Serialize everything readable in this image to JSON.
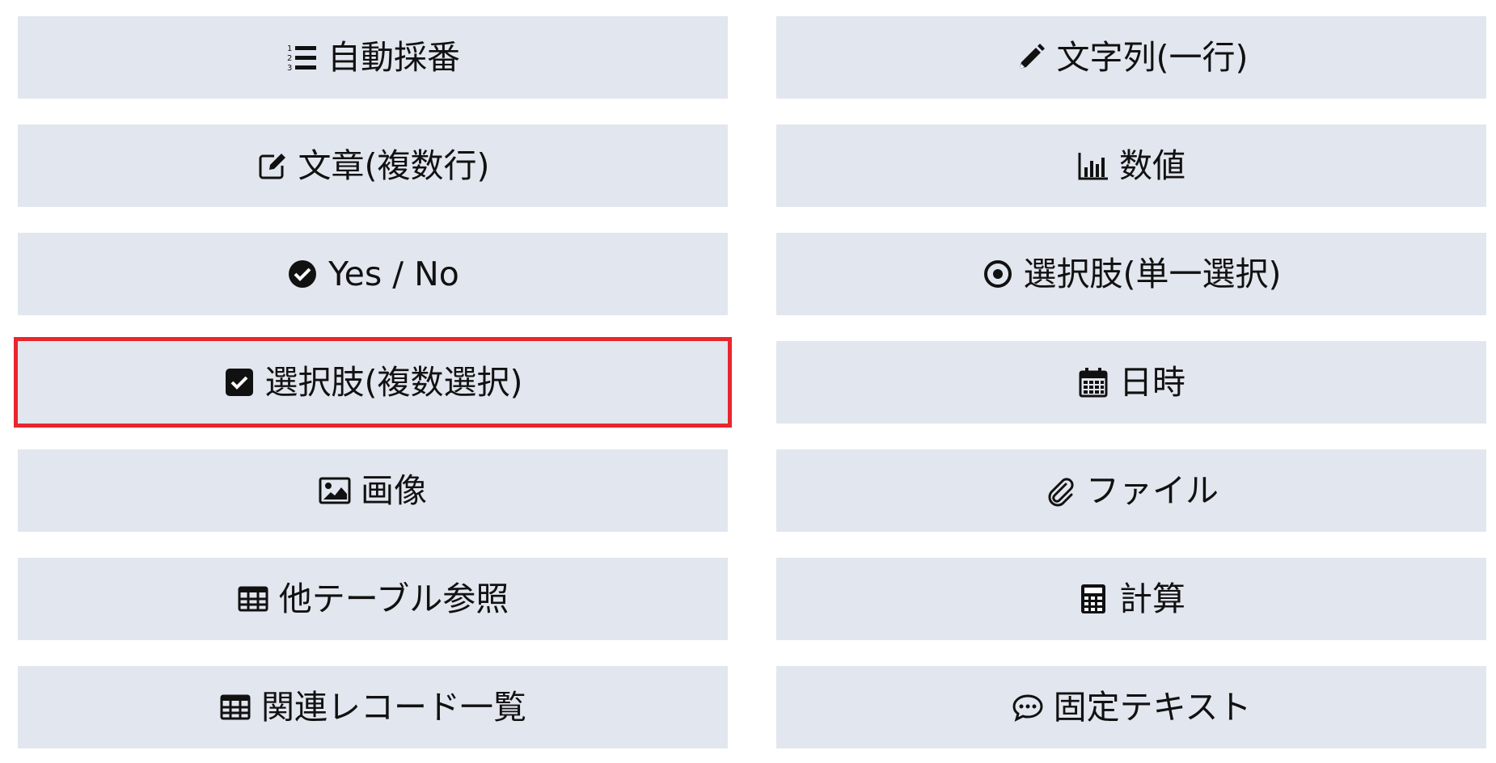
{
  "field_types": {
    "auto_number": {
      "label": "自動採番",
      "icon": "ordered-list-icon"
    },
    "text_single": {
      "label": "文字列(一行)",
      "icon": "pencil-icon"
    },
    "text_multi": {
      "label": "文章(複数行)",
      "icon": "edit-icon"
    },
    "number": {
      "label": "数値",
      "icon": "bar-chart-icon"
    },
    "yes_no": {
      "label": "Yes / No",
      "icon": "check-circle-icon"
    },
    "radio": {
      "label": "選択肢(単一選択)",
      "icon": "radio-dot-icon"
    },
    "checkbox": {
      "label": "選択肢(複数選択)",
      "icon": "check-square-icon"
    },
    "datetime": {
      "label": "日時",
      "icon": "calendar-icon"
    },
    "image": {
      "label": "画像",
      "icon": "image-icon"
    },
    "file": {
      "label": "ファイル",
      "icon": "paperclip-icon"
    },
    "lookup": {
      "label": "他テーブル参照",
      "icon": "table-icon"
    },
    "calc": {
      "label": "計算",
      "icon": "calculator-icon"
    },
    "related_list": {
      "label": "関連レコード一覧",
      "icon": "table-icon"
    },
    "fixed_text": {
      "label": "固定テキスト",
      "icon": "comment-icon"
    }
  },
  "selected": "checkbox",
  "colors": {
    "button_bg": "#e2e6ee",
    "selected_border": "#e8262e",
    "text": "#111111"
  }
}
